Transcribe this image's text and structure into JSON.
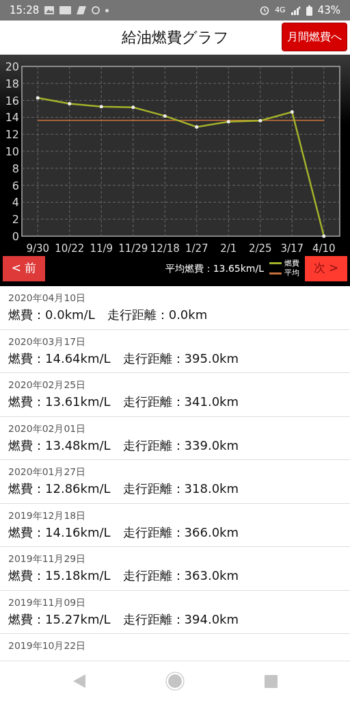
{
  "status_bar": {
    "time": "15:28",
    "network": "4G",
    "battery": "43%"
  },
  "header": {
    "title": "給油燃費グラフ",
    "action_button": "月間燃費へ"
  },
  "chart": {
    "chart_data": {
      "type": "line",
      "categories": [
        "9/30",
        "10/22",
        "11/9",
        "11/29",
        "12/18",
        "1/27",
        "2/1",
        "2/25",
        "3/17",
        "4/10"
      ],
      "ylim": [
        0,
        20
      ],
      "grid": true,
      "yticks": [
        0,
        2,
        4,
        6,
        8,
        10,
        12,
        14,
        16,
        18,
        20
      ],
      "series": [
        {
          "name": "燃費",
          "color": "#a4b22a",
          "values": [
            16.3,
            15.6,
            15.27,
            15.18,
            14.16,
            12.86,
            13.48,
            13.61,
            14.64,
            0
          ]
        },
        {
          "name": "平均",
          "color": "#c8703a",
          "values": [
            13.65,
            13.65,
            13.65,
            13.65,
            13.65,
            13.65,
            13.65,
            13.65,
            13.65,
            13.65
          ]
        }
      ]
    },
    "prev_button": {
      "label": "< 前",
      "disabled": false
    },
    "average_text": "平均燃費：13.65km/L",
    "next_button": {
      "label": "次 >",
      "disabled": true
    }
  },
  "records": [
    {
      "date": "2020年04月10日",
      "fuel_economy": "燃費：0.0km/L",
      "distance": "走行距離：0.0km"
    },
    {
      "date": "2020年03月17日",
      "fuel_economy": "燃費：14.64km/L",
      "distance": "走行距離：395.0km"
    },
    {
      "date": "2020年02月25日",
      "fuel_economy": "燃費：13.61km/L",
      "distance": "走行距離：341.0km"
    },
    {
      "date": "2020年02月01日",
      "fuel_economy": "燃費：13.48km/L",
      "distance": "走行距離：339.0km"
    },
    {
      "date": "2020年01月27日",
      "fuel_economy": "燃費：12.86km/L",
      "distance": "走行距離：318.0km"
    },
    {
      "date": "2019年12月18日",
      "fuel_economy": "燃費：14.16km/L",
      "distance": "走行距離：366.0km"
    },
    {
      "date": "2019年11月29日",
      "fuel_economy": "燃費：15.18km/L",
      "distance": "走行距離：363.0km"
    },
    {
      "date": "2019年11月09日",
      "fuel_economy": "燃費：15.27km/L",
      "distance": "走行距離：394.0km"
    },
    {
      "date": "2019年10月22日"
    }
  ]
}
